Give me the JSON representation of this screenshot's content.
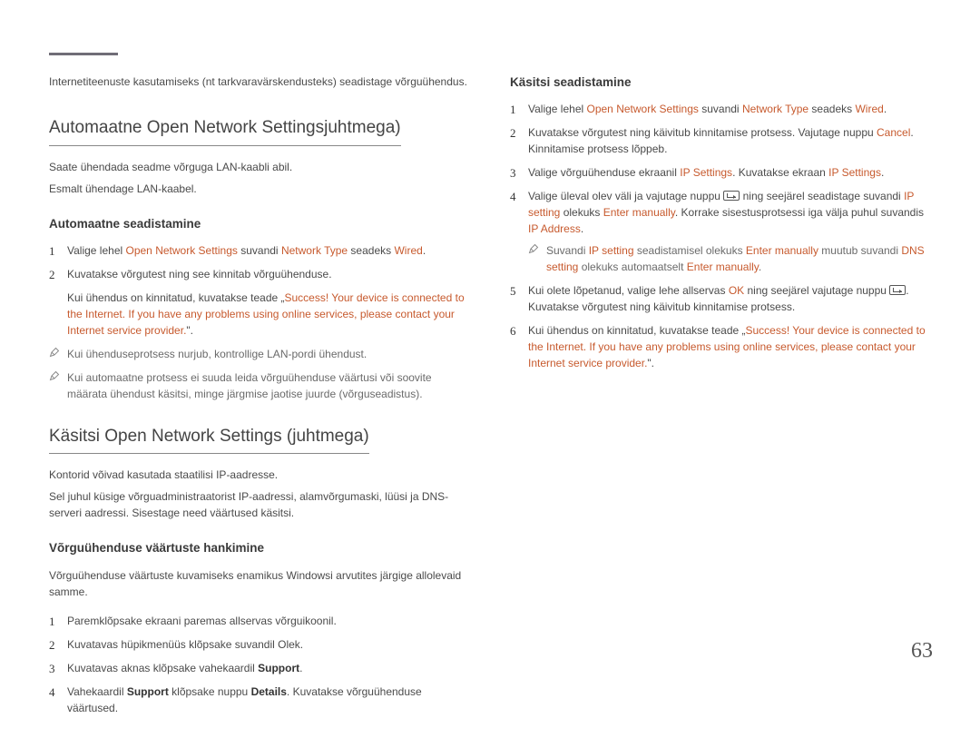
{
  "intro": "Internetiteenuste kasutamiseks (nt tarkvaravärskendusteks) seadistage võrguühendus.",
  "pageNumber": "63",
  "left": {
    "auto": {
      "heading": "Automaatne  Open Network Settingsjuhtmega)",
      "p1": "Saate ühendada seadme võrguga LAN-kaabli abil.",
      "p2": "Esmalt ühendage LAN-kaabel.",
      "sub": {
        "heading": "Automaatne seadistamine",
        "s1a": "Valige lehel ",
        "s1b": "Open Network Settings",
        "s1c": " suvandi ",
        "s1d": "Network Type",
        "s1e": " seadeks ",
        "s1f": "Wired",
        "s1g": ".",
        "s2": "Kuvatakse võrgutest ning see kinnitab võrguühenduse.",
        "s2fa": "Kui ühendus on kinnitatud, kuvatakse teade „",
        "s2fb": "Success! Your device is connected to the Internet. If you have any problems using online services, please contact your Internet service provider.",
        "s2fc": "\".",
        "n1": "Kui ühenduseprotsess nurjub, kontrollige LAN-pordi ühendust.",
        "n2": "Kui automaatne protsess ei suuda leida võrguühenduse väärtusi või soovite määrata ühendust käsitsi, minge järgmise jaotise juurde (võrguseadistus)."
      }
    },
    "manual": {
      "heading": "Käsitsi Open Network Settings (juhtmega)",
      "p1": "Kontorid võivad kasutada staatilisi IP-aadresse.",
      "p2": "Sel juhul küsige võrguadministraatorist IP-aadressi, alamvõrgumaski, lüüsi ja DNS-serveri aadressi. Sisestage need väärtused käsitsi.",
      "sub": {
        "heading": "Võrguühenduse väärtuste hankimine",
        "intro": "Võrguühenduse väärtuste kuvamiseks enamikus Windowsi arvutites järgige allolevaid samme.",
        "s1": "Paremklõpsake ekraani paremas allservas võrguikoonil.",
        "s2": "Kuvatavas hüpikmenüüs klõpsake suvandil Olek.",
        "s3a": "Kuvatavas aknas klõpsake vahekaardil ",
        "s3b": "Support",
        "s3c": ".",
        "s4a": "Vahekaardil ",
        "s4b": "Support",
        "s4c": " klõpsake nuppu ",
        "s4d": "Details",
        "s4e": ". Kuvatakse võrguühenduse väärtused."
      }
    }
  },
  "right": {
    "heading": "Käsitsi seadistamine",
    "s1a": "Valige lehel ",
    "s1b": "Open Network Settings",
    "s1c": " suvandi ",
    "s1d": "Network Type",
    "s1e": " seadeks ",
    "s1f": "Wired",
    "s1g": ".",
    "s2a": "Kuvatakse võrgutest ning käivitub kinnitamise protsess. Vajutage nuppu ",
    "s2b": "Cancel",
    "s2c": ". Kinnitamise protsess lõppeb.",
    "s3a": "Valige võrguühenduse ekraanil ",
    "s3b": "IP Settings",
    "s3c": ". Kuvatakse ekraan ",
    "s3d": "IP Settings",
    "s3e": ".",
    "s4a": "Valige üleval olev väli ja vajutage nuppu ",
    "s4b": " ning seejärel seadistage suvandi ",
    "s4c": "IP setting",
    "s4d": " olekuks ",
    "s4e": "Enter manually",
    "s4f": ". Korrake sisestusprotsessi iga välja puhul suvandis ",
    "s4g": "IP Address",
    "s4h": ".",
    "n4a": "Suvandi ",
    "n4b": "IP setting",
    "n4c": " seadistamisel olekuks ",
    "n4d": "Enter manually",
    "n4e": " muutub suvandi ",
    "n4f": "DNS setting",
    "n4g": " olekuks automaatselt ",
    "n4h": "Enter manually",
    "n4i": ".",
    "s5a": "Kui olete lõpetanud, valige lehe allservas ",
    "s5b": "OK",
    "s5c": " ning seejärel vajutage nuppu ",
    "s5d": ". Kuvatakse võrgutest ning käivitub kinnitamise protsess.",
    "s6a": "Kui ühendus on kinnitatud, kuvatakse teade „",
    "s6b": "Success! Your device is connected to the Internet. If you have any problems using online services, please contact your Internet service provider.",
    "s6c": "\"."
  }
}
